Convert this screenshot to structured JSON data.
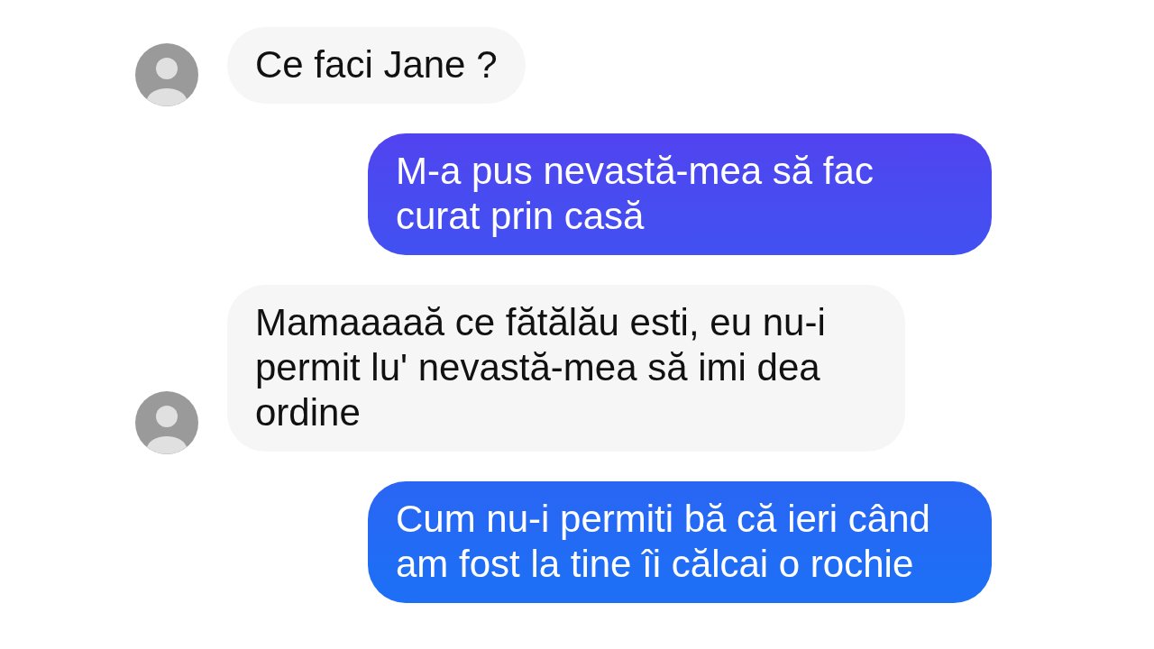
{
  "messages": [
    {
      "kind": "received",
      "avatar": true,
      "text": "Ce faci Jane ?"
    },
    {
      "kind": "sent",
      "text": "M-a pus nevastă-mea să fac curat prin casă"
    },
    {
      "kind": "received",
      "avatar": true,
      "text": "Mamaaaaă ce fătălău esti, eu nu-i permit lu' nevastă-mea să imi dea ordine"
    },
    {
      "kind": "sent",
      "text": "Cum nu-i permiti bă că ieri când am fost la tine îi călcai o rochie"
    }
  ]
}
